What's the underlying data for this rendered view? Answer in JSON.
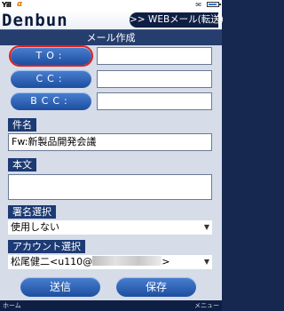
{
  "status_bar": {
    "signal_label": "Yill",
    "carrier_glyph": "α",
    "mail_icon": "mail-icon",
    "battery_icon": "battery-icon"
  },
  "header": {
    "logo": "Denbun",
    "mode_badge": ">> WEBメール(転送)"
  },
  "title": "メール作成",
  "recipients": {
    "to_label": "TO:",
    "cc_label": "CC:",
    "bcc_label": "BCC:",
    "to_value": "",
    "cc_value": "",
    "bcc_value": ""
  },
  "subject": {
    "label": "件名",
    "value": "Fw:新製品開発会議"
  },
  "body": {
    "label": "本文",
    "value": ""
  },
  "signature": {
    "label": "署名選択",
    "selected": "使用しない"
  },
  "account": {
    "label": "アカウント選択",
    "selected_prefix": "松尾健二<u110@",
    "selected_suffix": ">"
  },
  "actions": {
    "send": "送信",
    "save": "保存"
  },
  "softkeys": {
    "left": "ホーム",
    "right": "メニュー"
  },
  "colors": {
    "background": "#16284f",
    "button_blue": "#1d4ea0",
    "section_label": "#1c3a73",
    "selection_outline": "#e02020"
  }
}
